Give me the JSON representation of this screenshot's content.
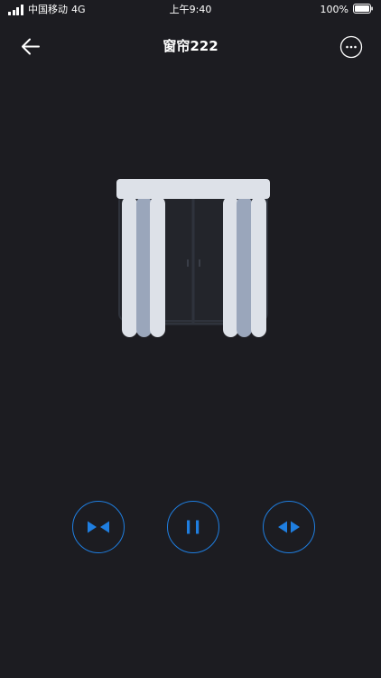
{
  "status_bar": {
    "carrier": "中国移动",
    "network": "4G",
    "time": "上午9:40",
    "battery_percent": "100%"
  },
  "nav": {
    "title": "窗帘222"
  },
  "icons": {
    "back": "arrow-left-icon",
    "more": "more-horizontal-icon",
    "close_curtain": "close-curtain-icon",
    "pause": "pause-icon",
    "open_curtain": "open-curtain-icon"
  },
  "colors": {
    "background": "#1c1c21",
    "accent": "#1f7ee0",
    "curtain_light": "#dde1e8",
    "curtain_dark": "#9aa6bb",
    "window_frame": "#2f333c"
  }
}
